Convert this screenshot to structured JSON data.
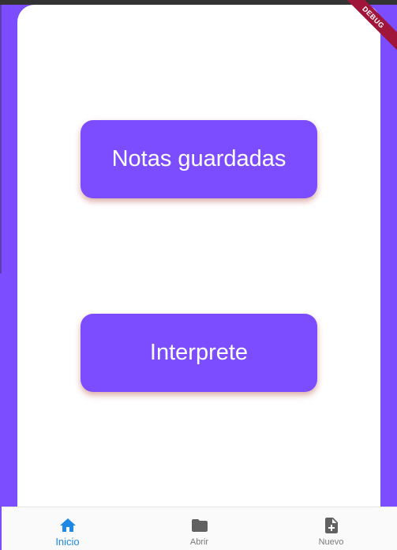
{
  "colors": {
    "accent": "#7c4dff",
    "nav_active": "#1e88e5",
    "nav_inactive": "#616161",
    "debug_banner": "#a0163a"
  },
  "main": {
    "buttons": [
      {
        "label": "Notas guardadas"
      },
      {
        "label": "Interprete"
      }
    ]
  },
  "debug_banner": {
    "label": "DEBUG"
  },
  "bottom_nav": {
    "items": [
      {
        "label": "Inicio",
        "icon": "home-icon",
        "active": true
      },
      {
        "label": "Abrir",
        "icon": "folder-icon",
        "active": false
      },
      {
        "label": "Nuevo",
        "icon": "new-file-icon",
        "active": false
      }
    ]
  }
}
